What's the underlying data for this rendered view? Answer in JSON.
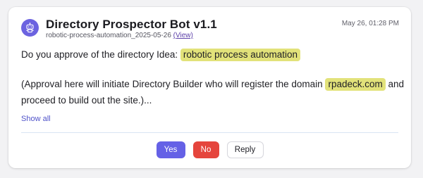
{
  "message": {
    "bot_name": "Directory Prospector Bot v1.1",
    "subtitle": "robotic-process-automation_2025-05-26",
    "view_link": "(View)",
    "timestamp": "May 26, 01:28 PM",
    "line1_prefix": "Do you approve of the directory Idea:",
    "line1_highlight": "robotic process automation",
    "line2_prefix": "(Approval here will initiate Directory Builder who will register the domain",
    "line2_highlight": "rpadeck.com",
    "line2_suffix": "and",
    "line3": "proceed to build out the site.)...",
    "show_all": "Show all"
  },
  "actions": {
    "yes_label": "Yes",
    "no_label": "No",
    "reply_label": "Reply"
  },
  "colors": {
    "avatar": "#6c63e0",
    "highlight": "#e2e27a",
    "yes": "#6561e6",
    "no": "#e5453d",
    "link": "#4f52c9"
  },
  "icons": {
    "avatar": "robot-icon"
  }
}
